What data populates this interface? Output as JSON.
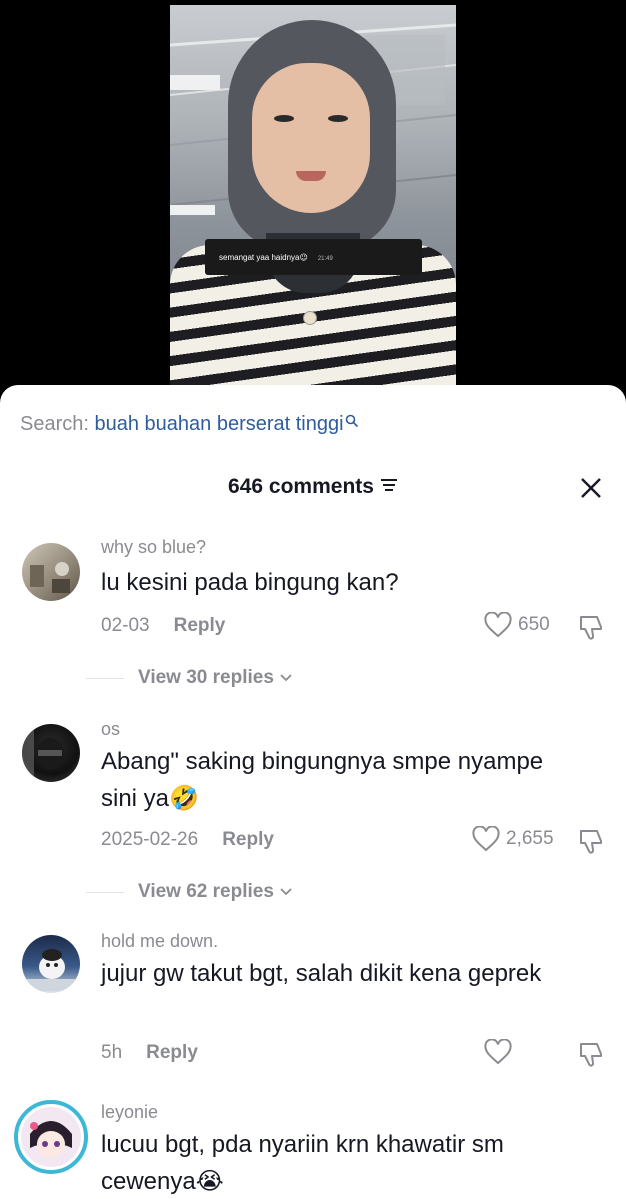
{
  "video": {
    "overlay_message": "semangat yaa haidnya😉",
    "overlay_time": "21:49"
  },
  "search": {
    "prefix": "Search: ",
    "query": "buah buahan berserat tinggi",
    "icon": "search-icon"
  },
  "comments_header": {
    "count_label": "646 comments",
    "filter_icon": "filter-icon",
    "close_icon": "close-icon"
  },
  "comments": [
    {
      "username": "why so blue?",
      "text": "lu kesini pada bingung kan?",
      "date": "02-03",
      "reply_label": "Reply",
      "likes": "650",
      "view_replies": "View 30 replies"
    },
    {
      "username": "os",
      "text": "Abang\" saking bingungnya smpe nyampe sini ya🤣",
      "date": "2025-02-26",
      "reply_label": "Reply",
      "likes": "2,655",
      "view_replies": "View 62 replies"
    },
    {
      "username": "hold me down.",
      "text": "jujur gw takut bgt, salah dikit kena geprek",
      "date": "5h",
      "reply_label": "Reply",
      "likes": ""
    },
    {
      "username": "leyonie",
      "text": "lucuu bgt, pda nyariin krn khawatir sm cewenya😭"
    }
  ],
  "colors": {
    "link_blue": "#2f5c9d",
    "muted_gray": "#8a8b91",
    "text_dark": "#161823"
  }
}
